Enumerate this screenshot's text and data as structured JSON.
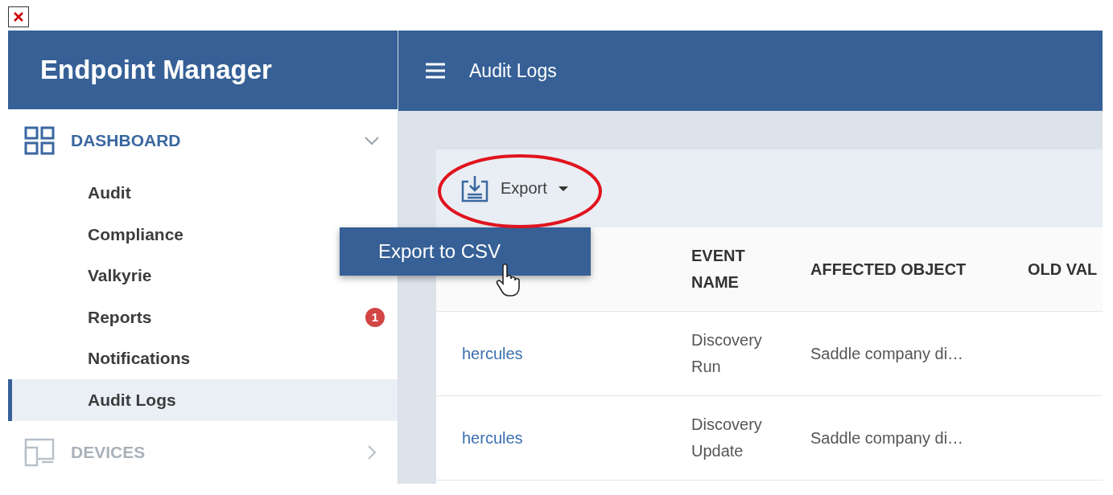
{
  "app": {
    "title": "Endpoint Manager"
  },
  "sidebar": {
    "sections": [
      {
        "label": "DASHBOARD",
        "kind": "dashboard",
        "expanded": true,
        "disabled": false,
        "items": [
          {
            "label": "Audit",
            "selected": false
          },
          {
            "label": "Compliance",
            "selected": false
          },
          {
            "label": "Valkyrie",
            "selected": false
          },
          {
            "label": "Reports",
            "selected": false,
            "badge": "1"
          },
          {
            "label": "Notifications",
            "selected": false
          },
          {
            "label": "Audit Logs",
            "selected": true
          }
        ]
      },
      {
        "label": "DEVICES",
        "kind": "devices",
        "expanded": false,
        "disabled": true
      }
    ]
  },
  "header": {
    "title": "Audit Logs"
  },
  "toolbar": {
    "export_button": "Export"
  },
  "export_menu": {
    "items": [
      "Export to CSV"
    ]
  },
  "table": {
    "columns": [
      "",
      "EVENT NAME",
      "AFFECTED OBJECT",
      "OLD VAL"
    ],
    "rows": [
      {
        "cells": [
          "hercules",
          "Discovery Run",
          "Saddle company di…"
        ]
      },
      {
        "cells": [
          "hercules",
          "Discovery Update",
          "Saddle company di…"
        ]
      }
    ]
  }
}
